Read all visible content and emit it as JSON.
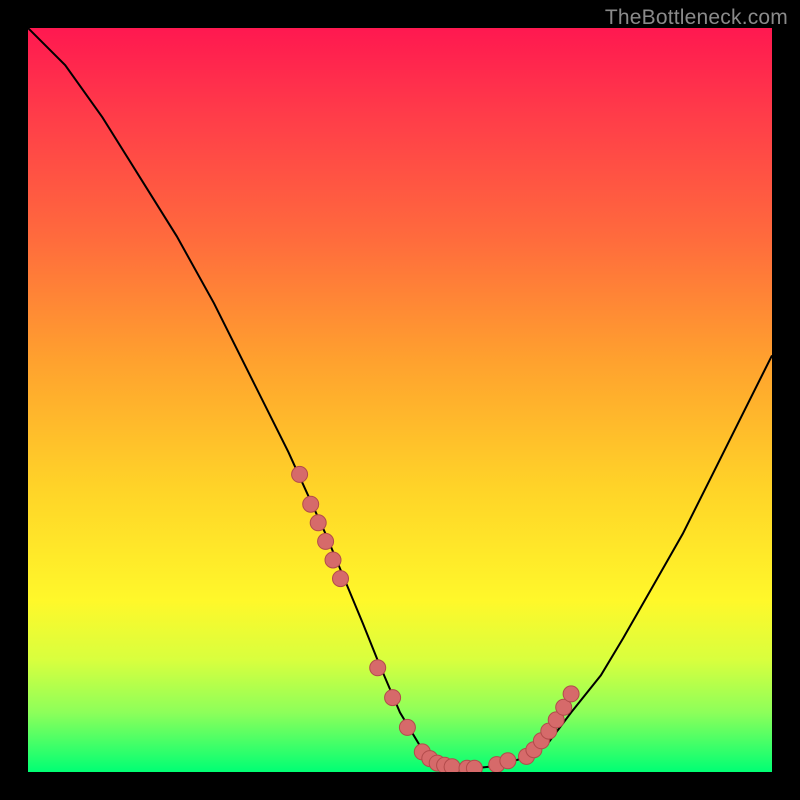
{
  "watermark": "TheBottleneck.com",
  "colors": {
    "background": "#000000",
    "curve": "#000000",
    "dot_fill": "#d66a6a",
    "dot_stroke": "#b24b4b"
  },
  "chart_data": {
    "type": "line",
    "title": "",
    "xlabel": "",
    "ylabel": "",
    "xlim": [
      0,
      100
    ],
    "ylim": [
      0,
      100
    ],
    "curve": {
      "x": [
        0,
        5,
        10,
        15,
        20,
        25,
        30,
        35,
        40,
        45,
        47,
        50,
        53,
        56,
        60,
        63,
        67,
        70,
        73,
        77,
        80,
        84,
        88,
        92,
        96,
        100
      ],
      "y": [
        100,
        95,
        88,
        80,
        72,
        63,
        53,
        43,
        32,
        20,
        15,
        8,
        3,
        1,
        0.5,
        0.8,
        2,
        4,
        8,
        13,
        18,
        25,
        32,
        40,
        48,
        56
      ]
    },
    "dots": {
      "x": [
        36.5,
        38,
        39,
        40,
        41,
        42,
        47,
        49,
        51,
        53,
        54,
        55,
        56,
        57,
        59,
        60,
        63,
        64.5,
        67,
        68,
        69,
        70,
        71,
        72,
        73
      ],
      "y": [
        40,
        36,
        33.5,
        31,
        28.5,
        26,
        14,
        10,
        6,
        2.7,
        1.8,
        1.2,
        0.9,
        0.7,
        0.5,
        0.5,
        1.0,
        1.5,
        2.1,
        3.0,
        4.2,
        5.5,
        7.0,
        8.7,
        10.5
      ],
      "radius": 8
    }
  }
}
